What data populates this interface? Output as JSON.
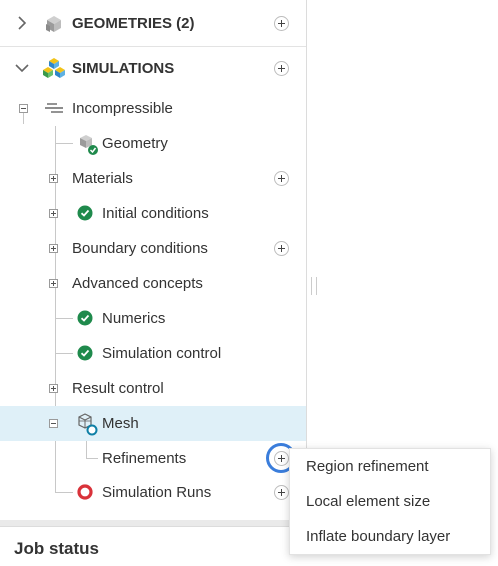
{
  "tree": {
    "geometries_label": "GEOMETRIES (2)",
    "simulations_label": "SIMULATIONS",
    "incompressible_label": "Incompressible",
    "geometry_label": "Geometry",
    "materials_label": "Materials",
    "initial_conditions_label": "Initial conditions",
    "boundary_conditions_label": "Boundary conditions",
    "advanced_concepts_label": "Advanced concepts",
    "numerics_label": "Numerics",
    "simulation_control_label": "Simulation control",
    "result_control_label": "Result control",
    "mesh_label": "Mesh",
    "refinements_label": "Refinements",
    "simulation_runs_label": "Simulation Runs"
  },
  "context_menu": {
    "items": [
      "Region refinement",
      "Local element size",
      "Inflate boundary layer"
    ]
  },
  "job_status": {
    "title": "Job status"
  },
  "colors": {
    "selected_row": "#dff0f8",
    "check_green": "#1f8a4c",
    "run_red": "#d9323a",
    "highlight_ring": "#3a7ddb",
    "mesh_badge": "#0e7fa6"
  },
  "icons": [
    "chevron-right-icon",
    "chevron-down-icon",
    "cube-icon",
    "simulation-cubes-icon",
    "settings-lines-icon",
    "check-circle-icon",
    "run-ring-icon",
    "add-circle-icon",
    "mesh-icon"
  ]
}
